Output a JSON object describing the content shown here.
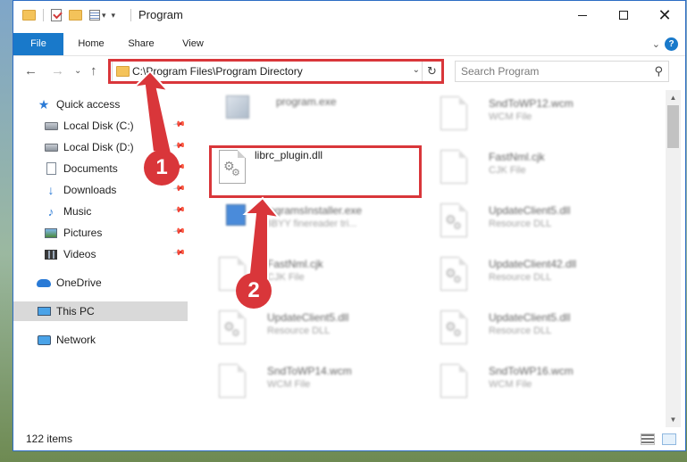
{
  "window": {
    "title": "Program"
  },
  "ribbon": {
    "tabs": [
      {
        "label": "File",
        "active": true
      },
      {
        "label": "Home"
      },
      {
        "label": "Share"
      },
      {
        "label": "View"
      }
    ],
    "help": "?"
  },
  "nav": {
    "address": "C:\\Program Files\\Program Directory",
    "search_placeholder": "Search Program"
  },
  "sidebar": {
    "items": [
      {
        "label": "Quick access",
        "icon": "star-icon",
        "pinned": false
      },
      {
        "label": "Local Disk (C:)",
        "icon": "disk-icon",
        "pinned": true
      },
      {
        "label": "Local Disk (D:)",
        "icon": "disk-icon",
        "pinned": true
      },
      {
        "label": "Documents",
        "icon": "documents-icon",
        "pinned": true
      },
      {
        "label": "Downloads",
        "icon": "downloads-icon",
        "pinned": true
      },
      {
        "label": "Music",
        "icon": "music-icon",
        "pinned": true
      },
      {
        "label": "Pictures",
        "icon": "pictures-icon",
        "pinned": true
      },
      {
        "label": "Videos",
        "icon": "videos-icon",
        "pinned": true
      },
      {
        "label": "OneDrive",
        "icon": "onedrive-icon",
        "pinned": false
      },
      {
        "label": "This PC",
        "icon": "this-pc-icon",
        "pinned": false,
        "selected": true
      },
      {
        "label": "Network",
        "icon": "network-icon",
        "pinned": false
      }
    ]
  },
  "files": {
    "left": [
      {
        "name": "program.exe",
        "type": ""
      },
      {
        "name": "librc_plugin.dll",
        "type": ""
      },
      {
        "name": "ProgramsInstaller.exe",
        "type": "ABBYY finereader tri..."
      },
      {
        "name": "FastNml.cjk",
        "type": "CJK File"
      },
      {
        "name": "UpdateClient5.dll",
        "type": "Resource DLL"
      },
      {
        "name": "SndToWP14.wcm",
        "type": "WCM File"
      }
    ],
    "right": [
      {
        "name": "SndToWP12.wcm",
        "type": "WCM File"
      },
      {
        "name": "FastNml.cjk",
        "type": "CJK File"
      },
      {
        "name": "UpdateClient5.dll",
        "type": "Resource DLL"
      },
      {
        "name": "UpdateClient42.dll",
        "type": "Resource DLL"
      },
      {
        "name": "UpdateClient5.dll",
        "type": "Resource DLL"
      },
      {
        "name": "SndToWP16.wcm",
        "type": "WCM File"
      }
    ]
  },
  "status": {
    "item_count": "122 items"
  },
  "annotations": {
    "badge_1": "1",
    "badge_2": "2",
    "color": "#d9363a"
  }
}
